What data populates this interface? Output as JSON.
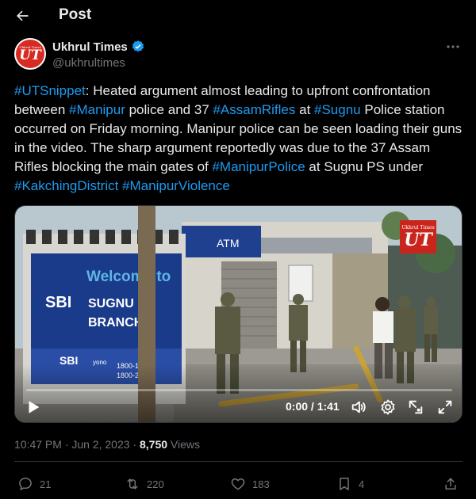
{
  "header": {
    "title": "Post",
    "back_icon": "arrow-left-icon"
  },
  "author": {
    "name": "Ukhrul Times",
    "handle": "@ukhrultimes",
    "avatar_top_text": "Ukhrul Times",
    "avatar_logo": "UT",
    "verified_color": "#1d9bf0"
  },
  "tweet": {
    "segments": [
      {
        "text": "#UTSnippet",
        "tag": true
      },
      {
        "text": ": Heated argument almost leading to upfront confrontation between ",
        "tag": false
      },
      {
        "text": "#Manipur",
        "tag": true
      },
      {
        "text": " police and 37 ",
        "tag": false
      },
      {
        "text": "#AssamRifles",
        "tag": true
      },
      {
        "text": " at ",
        "tag": false
      },
      {
        "text": "#Sugnu",
        "tag": true
      },
      {
        "text": " Police station occurred on Friday morning. Manipur police can be seen loading their guns in the video. The sharp argument reportedly was due to the 37 Assam Rifles blocking the main gates of ",
        "tag": false
      },
      {
        "text": "#ManipurPolice",
        "tag": true
      },
      {
        "text": " at Sugnu PS under ",
        "tag": false
      },
      {
        "text": "#KakchingDistrict",
        "tag": true
      },
      {
        "text": " ",
        "tag": false
      },
      {
        "text": "#ManipurViolence",
        "tag": true
      }
    ]
  },
  "video": {
    "time": "0:00 / 1:41",
    "progress": 0,
    "watermark_top": "Ukhrul Times",
    "watermark_logo": "UT",
    "scene_text": {
      "atm": "ATM",
      "welcome": "Welcome to",
      "sbi": "SBI",
      "sugnu": "SUGNU",
      "branch": "BRANCH",
      "yono": "yono",
      "phone1": "1800-12",
      "phone2": "1800-21"
    }
  },
  "meta": {
    "timestamp": "10:47 PM · Jun 2, 2023 · ",
    "views_count": "8,750",
    "views_label": " Views"
  },
  "actions": {
    "replies": "21",
    "reposts": "220",
    "likes": "183",
    "bookmarks": "4"
  },
  "colors": {
    "link": "#1d9bf0",
    "muted": "#71767b",
    "text": "#e7e9ea"
  }
}
